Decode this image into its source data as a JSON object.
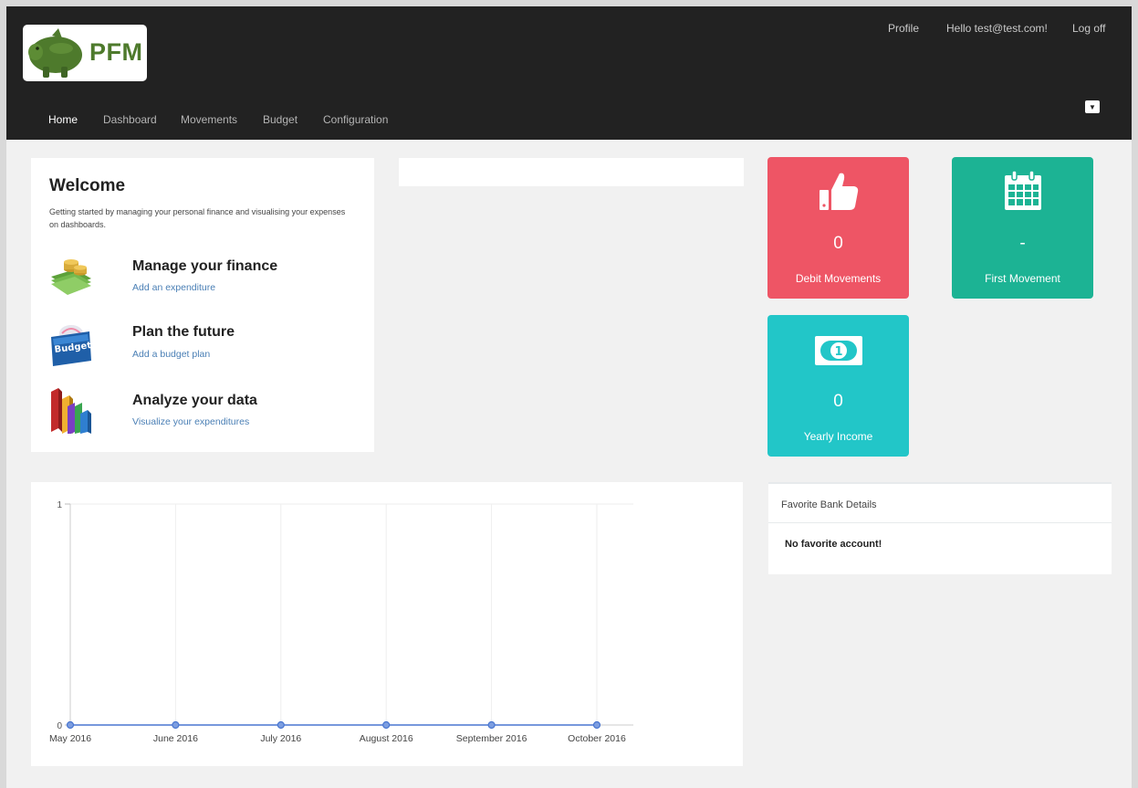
{
  "header": {
    "logo_text": "PFM",
    "top_links": {
      "profile": "Profile",
      "hello": "Hello test@test.com!",
      "logoff": "Log off"
    },
    "nav": [
      {
        "label": "Home",
        "active": true
      },
      {
        "label": "Dashboard",
        "active": false
      },
      {
        "label": "Movements",
        "active": false
      },
      {
        "label": "Budget",
        "active": false
      },
      {
        "label": "Configuration",
        "active": false
      }
    ],
    "dropdown_icon": "caret-down-icon",
    "background": "#222222"
  },
  "welcome": {
    "title": "Welcome",
    "description": "Getting started by managing your personal finance and visualising your expenses on dashboards.",
    "features": [
      {
        "title": "Manage your finance",
        "link": "Add an expenditure",
        "icon": "money-stack-icon"
      },
      {
        "title": "Plan the future",
        "link": "Add a budget plan",
        "icon": "budget-folder-icon"
      },
      {
        "title": "Analyze your data",
        "link": "Visualize your expenditures",
        "icon": "bar-chart-icon"
      }
    ]
  },
  "tiles": [
    {
      "value": "0",
      "label": "Debit Movements",
      "icon": "thumbs-up-icon",
      "color": "#ee5565"
    },
    {
      "value": "-",
      "label": "First Movement",
      "icon": "calendar-icon",
      "color": "#1cb394"
    },
    {
      "value": "0",
      "label": "Yearly Income",
      "icon": "money-bill-icon",
      "color": "#22c6c8"
    }
  ],
  "bank": {
    "title": "Favorite Bank Details",
    "message": "No favorite account!"
  },
  "chart_data": {
    "type": "line",
    "x": [
      "May 2016",
      "June 2016",
      "July 2016",
      "August 2016",
      "September 2016",
      "October 2016"
    ],
    "series": [
      {
        "values": [
          0,
          0,
          0,
          0,
          0,
          0
        ],
        "color": "#4a77d1"
      }
    ],
    "yticks": [
      "0",
      "1"
    ],
    "ylim": [
      0,
      1
    ],
    "grid": true
  }
}
